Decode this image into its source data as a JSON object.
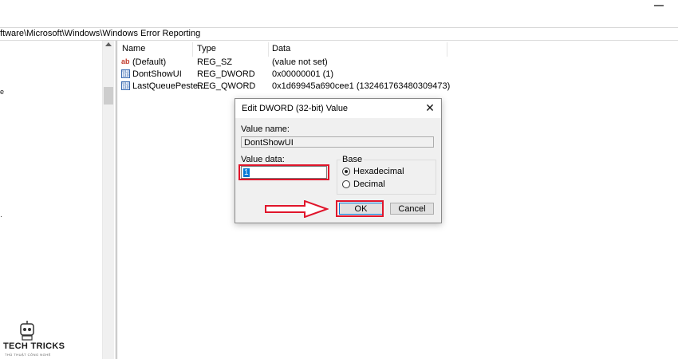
{
  "address": "ftware\\Microsoft\\Windows\\Windows Error Reporting",
  "columns": {
    "name": "Name",
    "type": "Type",
    "data": "Data"
  },
  "rows": [
    {
      "icon": "ab",
      "name": "(Default)",
      "type": "REG_SZ",
      "data": "(value not set)"
    },
    {
      "icon": "bin",
      "name": "DontShowUI",
      "type": "REG_DWORD",
      "data": "0x00000001 (1)"
    },
    {
      "icon": "bin",
      "name": "LastQueuePeste...",
      "type": "REG_QWORD",
      "data": "0x1d69945a690cee1 (132461763480309473)"
    }
  ],
  "dialog": {
    "title": "Edit DWORD (32-bit) Value",
    "value_name_label": "Value name:",
    "value_name": "DontShowUI",
    "value_data_label": "Value data:",
    "value_data": "1",
    "base_label": "Base",
    "hex_label": "Hexadecimal",
    "dec_label": "Decimal",
    "selected_base": "Hexadecimal",
    "ok_label": "OK",
    "cancel_label": "Cancel",
    "close_glyph": "✕"
  },
  "watermark": {
    "title": "TECH TRICKS",
    "subtitle": "THỦ THUẬT CÔNG NGHỆ"
  },
  "colors": {
    "highlight": "#e0152b",
    "selection": "#0078d7"
  },
  "icons": {
    "string_value": "registry-string-icon",
    "binary_value": "registry-binary-icon"
  }
}
